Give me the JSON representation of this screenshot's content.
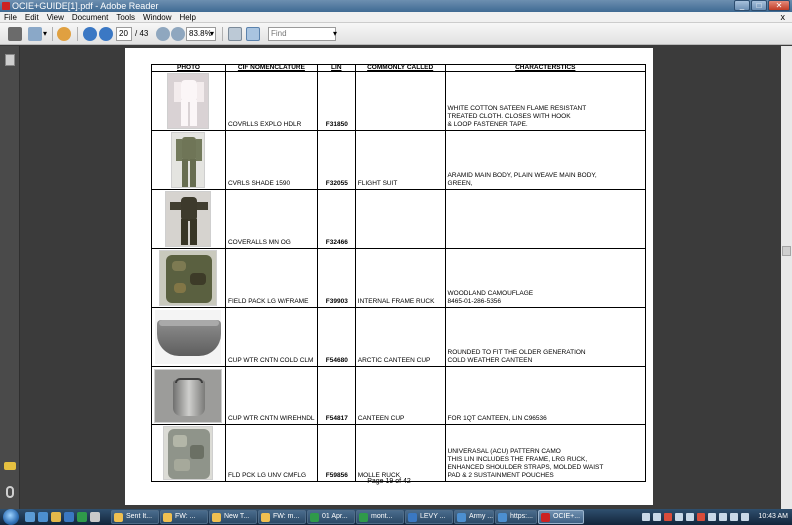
{
  "window": {
    "title": "OCIE+GUIDE[1].pdf - Adobe Reader",
    "btn_min": "_",
    "btn_max": "□",
    "btn_close": "✕"
  },
  "menu": {
    "items": [
      "File",
      "Edit",
      "View",
      "Document",
      "Tools",
      "Window",
      "Help"
    ],
    "close_glyph": "x"
  },
  "toolbar": {
    "page_current": "20",
    "page_total": "/ 43",
    "zoom": "83.8%",
    "find_placeholder": "Find"
  },
  "table": {
    "headers": [
      "PHOTO",
      "CIF NOMENCLATURE",
      "LIN",
      "COMMONLY CALLED",
      "CHARACTERSTICS"
    ],
    "rows": [
      {
        "nomenclature": "COVRLLS EXPLO HDLR",
        "lin": "F31850",
        "called": "",
        "char": "WHITE COTTON SATEEN FLAME RESISTANT\nTREATED CLOTH. CLOSES WITH HOOK\n& LOOP FASTENER TAPE."
      },
      {
        "nomenclature": "CVRLS SHADE 1590",
        "lin": "F32055",
        "called": "FLIGHT SUIT",
        "char": "ARAMID MAIN BODY, PLAIN WEAVE MAIN BODY,\nGREEN,"
      },
      {
        "nomenclature": "COVERALLS MN OG",
        "lin": "F32466",
        "called": "",
        "char": ""
      },
      {
        "nomenclature": "FIELD PACK LG W/FRAME",
        "lin": "F39903",
        "called": "INTERNAL FRAME RUCK",
        "char": "WOODLAND CAMOUFLAGE\n8465-01-286-5356"
      },
      {
        "nomenclature": "CUP WTR CNTN COLD CLM",
        "lin": "F54680",
        "called": "ARCTIC CANTEEN CUP",
        "char": "ROUNDED TO FIT THE OLDER GENERATION\nCOLD WEATHER CANTEEN"
      },
      {
        "nomenclature": "CUP WTR CNTN WIREHNDL",
        "lin": "F54817",
        "called": "CANTEEN CUP",
        "char": "FOR 1QT CANTEEN, LIN C96536"
      },
      {
        "nomenclature": "FLD PCK LG UNV CMFLG",
        "lin": "F59856",
        "called": "MOLLE RUCK",
        "char": "UNIVERASAL (ACU) PATTERN CAMO\nTHIS LIN INCLUDES THE FRAME, LRG RUCK,\nENHANCED SHOULDER STRAPS, MOLDED WAIST\nPAD & 2 SUSTAINMENT POUCHES"
      }
    ]
  },
  "footer": "Page 19 of 42",
  "taskbar": {
    "items": [
      "Sent It...",
      "FW: ...",
      "New T...",
      "FW: m...",
      "01 Apr...",
      "mont...",
      "LEVY ...",
      "Army ...",
      "https:...",
      "OCIE+..."
    ],
    "clock": "10:43 AM"
  },
  "colors": {
    "accent": "#3f6a93",
    "doc_bg": "#3b3b3b"
  }
}
